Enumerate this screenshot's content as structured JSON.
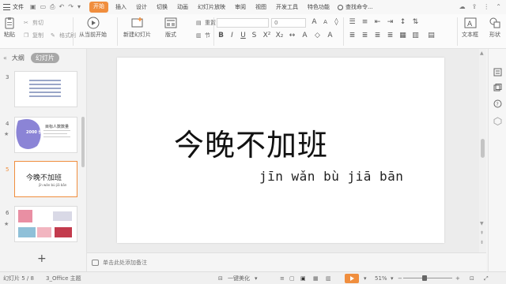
{
  "menubar": {
    "file_label": "文件",
    "tabs": [
      {
        "label": "开始",
        "active": true
      },
      {
        "label": "插入"
      },
      {
        "label": "设计"
      },
      {
        "label": "切换"
      },
      {
        "label": "动画"
      },
      {
        "label": "幻灯片放映"
      },
      {
        "label": "审阅"
      },
      {
        "label": "视图"
      },
      {
        "label": "开发工具"
      },
      {
        "label": "特色功能"
      }
    ],
    "search_label": "查找命令..."
  },
  "ribbon": {
    "paste": "粘贴",
    "cut": "剪切",
    "copy": "复制",
    "format_painter": "格式刷",
    "play_from_current": "从当前开始",
    "new_slide": "新建幻灯片",
    "layout": "版式",
    "section": "节",
    "reset": "重置",
    "font_size": "0",
    "textbox": "文本框",
    "shape": "形状"
  },
  "left_panel": {
    "tab_outline": "大纲",
    "tab_slides": "幻灯片",
    "thumbs": [
      {
        "num": "3"
      },
      {
        "num": "4",
        "title": "目标人数数量",
        "badge": "2000 份"
      },
      {
        "num": "5",
        "title": "今晚不加班",
        "pinyin": "jīn wǎn bù jiā bān",
        "selected": true
      },
      {
        "num": "6"
      }
    ]
  },
  "slide": {
    "title": "今晚不加班",
    "pinyin": "jīn wǎn bù jiā bān"
  },
  "notes": {
    "placeholder": "单击此处添加备注"
  },
  "status": {
    "slide_counter": "幻灯片 5 / 8",
    "theme": "3_Office 主题",
    "beautify": "一键美化",
    "zoom": "51%"
  },
  "colors": {
    "accent": "#f08e3e",
    "thumb_purple": "#8b84d6"
  }
}
